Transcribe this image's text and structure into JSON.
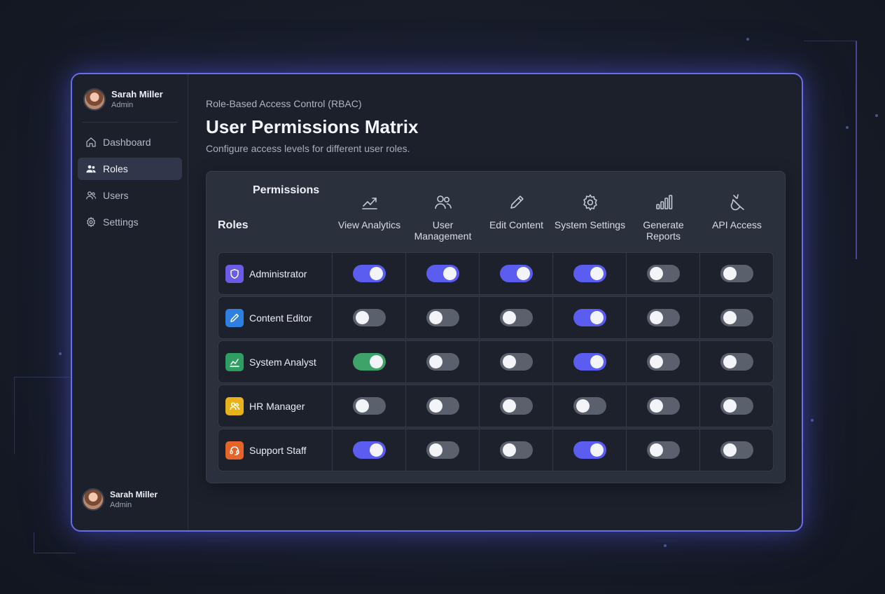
{
  "sidebar": {
    "profile": {
      "name": "Sarah Miller",
      "role": "Admin"
    },
    "nav": [
      {
        "label": "Dashboard",
        "icon": "home-icon",
        "active": false
      },
      {
        "label": "Roles",
        "icon": "users-group-icon",
        "active": true
      },
      {
        "label": "Users",
        "icon": "user-icon",
        "active": false
      },
      {
        "label": "Settings",
        "icon": "gear-icon",
        "active": false
      }
    ],
    "footer_profile": {
      "name": "Sarah Miller",
      "role": "Admin"
    }
  },
  "header": {
    "breadcrumb": "Role-Based Access Control (RBAC)",
    "title": "User Permissions Matrix",
    "subtitle": "Configure access levels for different user roles."
  },
  "matrix": {
    "permissions_heading": "Permissions",
    "roles_heading": "Roles",
    "columns": [
      {
        "label": "View Analytics",
        "icon": "chart-line-icon"
      },
      {
        "label": "User Management",
        "icon": "users-icon"
      },
      {
        "label": "Edit Content",
        "icon": "pencil-icon"
      },
      {
        "label": "System Settings",
        "icon": "gear-icon"
      },
      {
        "label": "Generate Reports",
        "icon": "bar-chart-icon"
      },
      {
        "label": "API Access",
        "icon": "plug-icon"
      }
    ],
    "rows": [
      {
        "role": "Administrator",
        "icon": "shield-icon",
        "color": "#6b5ce7",
        "permissions": [
          true,
          true,
          true,
          true,
          false,
          false
        ]
      },
      {
        "role": "Content Editor",
        "icon": "pencil-icon",
        "color": "#2d7fe0",
        "permissions": [
          false,
          false,
          false,
          true,
          false,
          false
        ]
      },
      {
        "role": "System Analyst",
        "icon": "chart-line-icon",
        "color": "#2f9e62",
        "permissions": [
          true,
          false,
          false,
          true,
          false,
          false
        ]
      },
      {
        "role": "HR Manager",
        "icon": "users-icon",
        "color": "#e8b21a",
        "permissions": [
          false,
          false,
          false,
          false,
          false,
          false
        ]
      },
      {
        "role": "Support Staff",
        "icon": "headset-icon",
        "color": "#e5642a",
        "permissions": [
          true,
          false,
          false,
          true,
          false,
          false
        ]
      }
    ],
    "toggle_colors": {
      "on": "#5b5cf0",
      "on_analyst": "#3ea368",
      "off": "#5a606c"
    }
  }
}
